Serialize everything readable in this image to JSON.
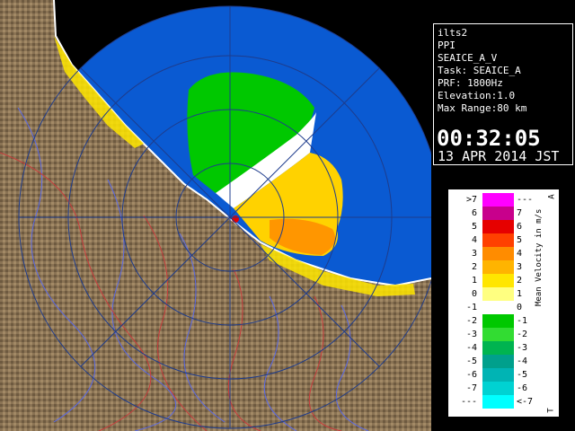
{
  "info": {
    "lines": [
      "ilts2",
      "PPI",
      "SEAICE_A_V",
      "Task: SEAICE_A",
      "PRF: 1800Hz",
      "Elevation:1.0",
      "Max Range:80 km"
    ],
    "time": "00:32:05",
    "date": "13 APR 2014 JST"
  },
  "legend": {
    "title": "Mean Velocity in m/s",
    "top_marker": "A",
    "bottom_marker": "T",
    "rows": [
      {
        "left": ">7",
        "right": "---",
        "color": "#ff00ff"
      },
      {
        "left": "6",
        "right": "7",
        "color": "#c8008c"
      },
      {
        "left": "5",
        "right": "6",
        "color": "#e60000"
      },
      {
        "left": "4",
        "right": "5",
        "color": "#ff4000"
      },
      {
        "left": "3",
        "right": "4",
        "color": "#ff8c00"
      },
      {
        "left": "2",
        "right": "3",
        "color": "#ffb400"
      },
      {
        "left": "1",
        "right": "2",
        "color": "#ffe600"
      },
      {
        "left": "0",
        "right": "1",
        "color": "#ffff80"
      },
      {
        "left": "-1",
        "right": "0",
        "color": "#ffffff"
      },
      {
        "left": "-2",
        "right": "-1",
        "color": "#00c800"
      },
      {
        "left": "-3",
        "right": "-2",
        "color": "#32dc32"
      },
      {
        "left": "-4",
        "right": "-3",
        "color": "#00b450"
      },
      {
        "left": "-5",
        "right": "-4",
        "color": "#00a08c"
      },
      {
        "left": "-6",
        "right": "-5",
        "color": "#00b4b4"
      },
      {
        "left": "-7",
        "right": "-6",
        "color": "#00d2d2"
      },
      {
        "left": "---",
        "right": "<-7",
        "color": "#00ffff"
      }
    ]
  },
  "colors": {
    "sea": "#0a5ad2",
    "outside_range": "#000000",
    "terrain": "#8a7354",
    "coastline": "#ffffff",
    "rivers": "#5a6ae6",
    "borders": "#c83c3c"
  }
}
